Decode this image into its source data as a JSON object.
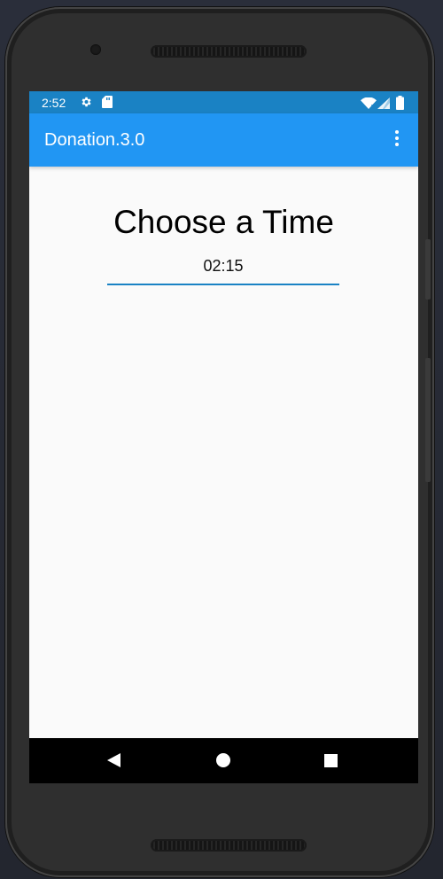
{
  "status_bar": {
    "time": "2:52",
    "background_color": "#1a82c4",
    "icons": [
      "gear-icon",
      "sd-card-icon",
      "wifi-icon",
      "cell-signal-icon",
      "battery-icon"
    ]
  },
  "app_bar": {
    "title": "Donation.3.0",
    "color": "#2196f3",
    "menu_icon": "overflow-menu-icon"
  },
  "main": {
    "heading": "Choose a Time",
    "time_field": {
      "value": "02:15",
      "underline_color": "#1a82c4"
    }
  },
  "nav_bar": {
    "buttons": [
      "back-icon",
      "home-icon",
      "recents-icon"
    ]
  }
}
